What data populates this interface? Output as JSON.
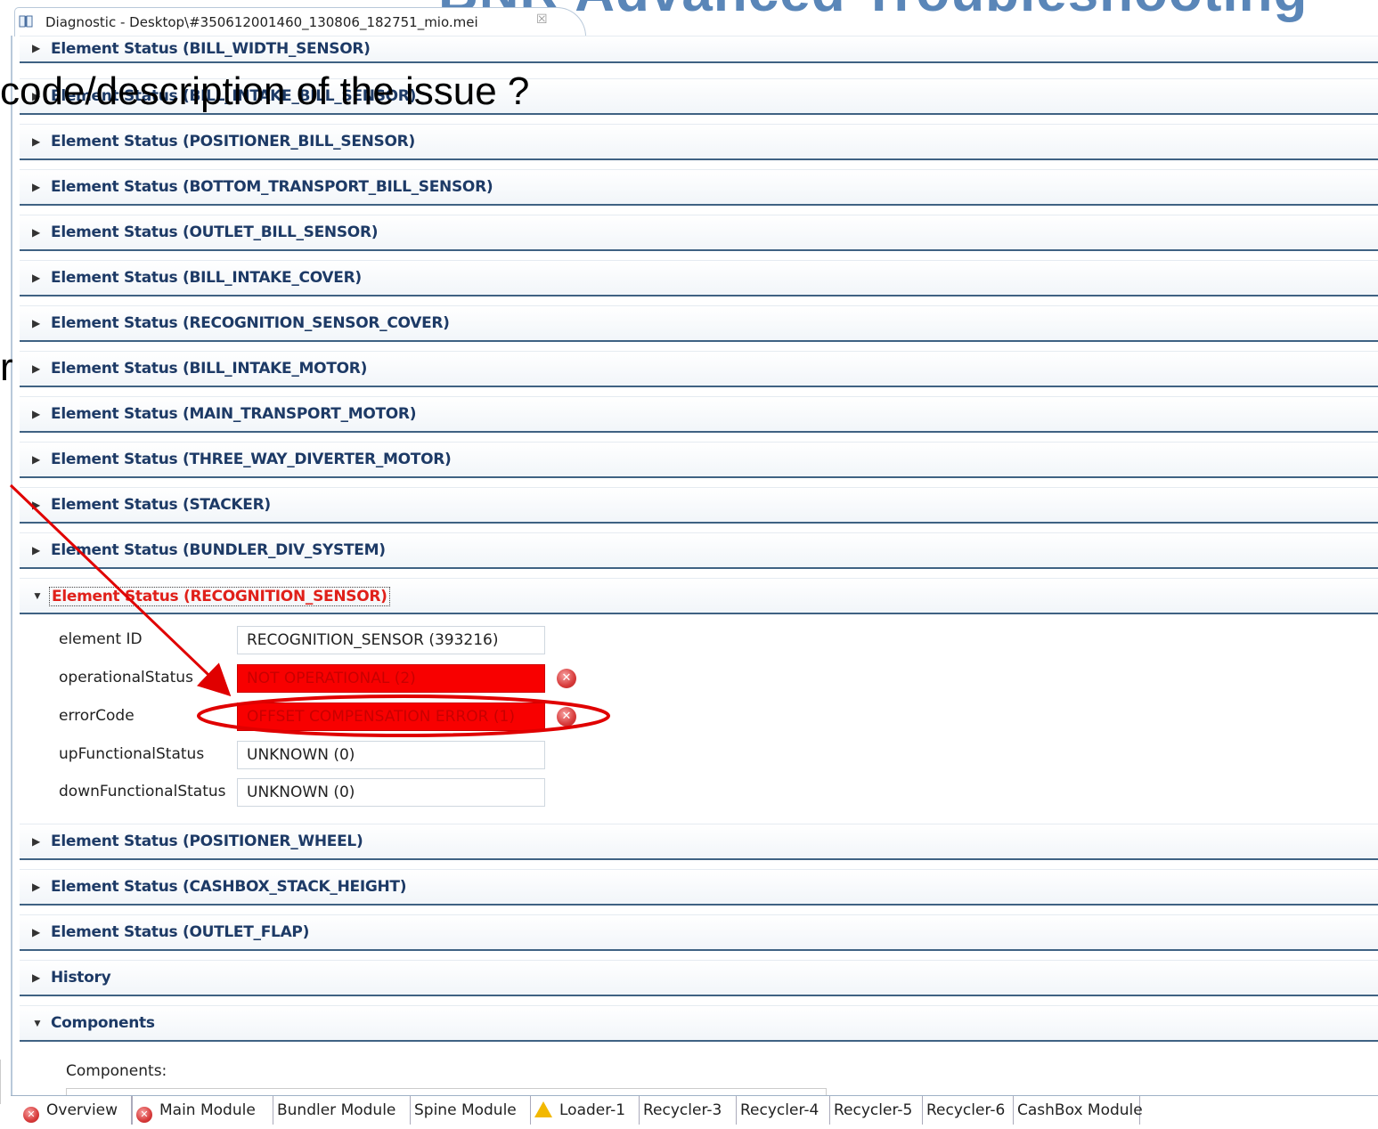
{
  "slide": {
    "title": "BNR Advanced Troubleshooting",
    "question": "code/description of the issue ?",
    "partial_char": "r"
  },
  "editor_tab": {
    "title": "Diagnostic - Desktop\\#350612001460_130806_182751_mio.mei",
    "close": "☒"
  },
  "sections": [
    {
      "label": "Element Status (BILL_WIDTH_SENSOR)",
      "state": "collapsed"
    },
    {
      "label": "Element Status (BILL_INTAKE_BILL_SENSOR)",
      "state": "collapsed"
    },
    {
      "label": "Element Status (POSITIONER_BILL_SENSOR)",
      "state": "collapsed"
    },
    {
      "label": "Element Status (BOTTOM_TRANSPORT_BILL_SENSOR)",
      "state": "collapsed"
    },
    {
      "label": "Element Status (OUTLET_BILL_SENSOR)",
      "state": "collapsed"
    },
    {
      "label": "Element Status (BILL_INTAKE_COVER)",
      "state": "collapsed"
    },
    {
      "label": "Element Status (RECOGNITION_SENSOR_COVER)",
      "state": "collapsed"
    },
    {
      "label": "Element Status (BILL_INTAKE_MOTOR)",
      "state": "collapsed"
    },
    {
      "label": "Element Status (MAIN_TRANSPORT_MOTOR)",
      "state": "collapsed"
    },
    {
      "label": "Element Status (THREE_WAY_DIVERTER_MOTOR)",
      "state": "collapsed"
    },
    {
      "label": "Element Status (STACKER)",
      "state": "collapsed"
    },
    {
      "label": "Element Status (BUNDLER_DIV_SYSTEM)",
      "state": "collapsed"
    },
    {
      "label": "Element Status (RECOGNITION_SENSOR)",
      "state": "expanded"
    },
    {
      "label": "Element Status (POSITIONER_WHEEL)",
      "state": "collapsed"
    },
    {
      "label": "Element Status (CASHBOX_STACK_HEIGHT)",
      "state": "collapsed"
    },
    {
      "label": "Element Status (OUTLET_FLAP)",
      "state": "collapsed"
    },
    {
      "label": "History",
      "state": "collapsed"
    },
    {
      "label": "Components",
      "state": "expanded"
    }
  ],
  "recognition_sensor": {
    "fields": [
      {
        "label": "element ID",
        "value": "RECOGNITION_SENSOR (393216)",
        "error": false
      },
      {
        "label": "operationalStatus",
        "value": "NOT OPERATIONAL (2)",
        "error": true
      },
      {
        "label": "errorCode",
        "value": "OFFSET COMPENSATION ERROR (1)",
        "error": true
      },
      {
        "label": "upFunctionalStatus",
        "value": "UNKNOWN (0)",
        "error": false
      },
      {
        "label": "downFunctionalStatus",
        "value": "UNKNOWN (0)",
        "error": false
      }
    ]
  },
  "components": {
    "label": "Components:"
  },
  "bottom_tabs": [
    {
      "label": "Overview",
      "icon": "error-icon"
    },
    {
      "label": "Main Module",
      "icon": "error-icon",
      "selected": true
    },
    {
      "label": "Bundler Module",
      "icon": ""
    },
    {
      "label": "Spine Module",
      "icon": ""
    },
    {
      "label": "Loader-1",
      "icon": "warning-icon"
    },
    {
      "label": "Recycler-3",
      "icon": ""
    },
    {
      "label": "Recycler-4",
      "icon": ""
    },
    {
      "label": "Recycler-5",
      "icon": ""
    },
    {
      "label": "Recycler-6",
      "icon": ""
    },
    {
      "label": "CashBox Module",
      "icon": ""
    }
  ],
  "colors": {
    "section_label": "#1d3a66",
    "active_label": "#e0201a",
    "error_field": "#f80000",
    "annotation": "#e00000"
  }
}
